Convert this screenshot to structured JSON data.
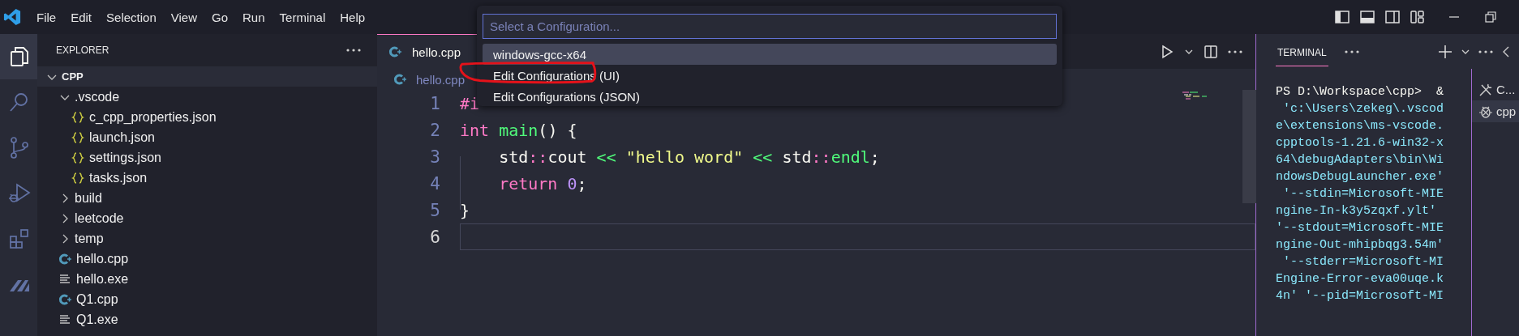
{
  "menu_bar": {
    "items": [
      "File",
      "Edit",
      "Selection",
      "View",
      "Go",
      "Run",
      "Terminal",
      "Help"
    ]
  },
  "activity_bar": [
    {
      "selected": true
    },
    {
      "selected": false
    },
    {
      "selected": false
    },
    {
      "selected": false
    },
    {
      "selected": false
    },
    {
      "selected": false
    }
  ],
  "explorer": {
    "title": "EXPLORER",
    "root": {
      "label": "CPP",
      "kind": "folder",
      "expanded": true,
      "children": [
        {
          "label": ".vscode",
          "kind": "folder",
          "expanded": true,
          "children": [
            {
              "label": "c_cpp_properties.json",
              "kind": "json"
            },
            {
              "label": "launch.json",
              "kind": "json"
            },
            {
              "label": "settings.json",
              "kind": "json"
            },
            {
              "label": "tasks.json",
              "kind": "json"
            }
          ]
        },
        {
          "label": "build",
          "kind": "folder",
          "expanded": false
        },
        {
          "label": "leetcode",
          "kind": "folder",
          "expanded": false
        },
        {
          "label": "temp",
          "kind": "folder",
          "expanded": false
        },
        {
          "label": "hello.cpp",
          "kind": "cpp"
        },
        {
          "label": "hello.exe",
          "kind": "exe"
        },
        {
          "label": "Q1.cpp",
          "kind": "cpp"
        },
        {
          "label": "Q1.exe",
          "kind": "exe"
        }
      ]
    }
  },
  "editor": {
    "tabs": [
      {
        "label": "hello.cpp",
        "selected": true
      }
    ],
    "breadcrumb": "hello.cpp",
    "lines": [
      {
        "number": "1",
        "current": false,
        "tokens": [
          {
            "text": "#i",
            "kind": "preproc"
          }
        ]
      },
      {
        "number": "2",
        "current": false,
        "tokens": [
          {
            "text": "int ",
            "kind": "keyword"
          },
          {
            "text": "main",
            "kind": "function"
          },
          {
            "text": "() {",
            "kind": "plain"
          }
        ]
      },
      {
        "number": "3",
        "current": false,
        "tokens": [
          {
            "text": "    std",
            "kind": "plain"
          },
          {
            "text": "::",
            "kind": "scope"
          },
          {
            "text": "cout ",
            "kind": "plain"
          },
          {
            "text": "<<",
            "kind": "operator"
          },
          {
            "text": " \"hello word\" ",
            "kind": "string"
          },
          {
            "text": "<<",
            "kind": "operator"
          },
          {
            "text": " std",
            "kind": "plain"
          },
          {
            "text": "::",
            "kind": "scope"
          },
          {
            "text": "endl",
            "kind": "function"
          },
          {
            "text": ";",
            "kind": "plain"
          }
        ]
      },
      {
        "number": "4",
        "current": false,
        "tokens": [
          {
            "text": "    return ",
            "kind": "keyword"
          },
          {
            "text": "0",
            "kind": "number"
          },
          {
            "text": ";",
            "kind": "plain"
          }
        ]
      },
      {
        "number": "5",
        "current": false,
        "tokens": [
          {
            "text": "}",
            "kind": "plain"
          }
        ]
      },
      {
        "number": "6",
        "current": true
      }
    ]
  },
  "command_palette": {
    "placeholder": "Select a Configuration...",
    "items": [
      {
        "label": "windows-gcc-x64",
        "selected": true
      },
      {
        "label": "Edit Configurations (UI)",
        "selected": false
      },
      {
        "label": "Edit Configurations (JSON)",
        "selected": false
      }
    ]
  },
  "terminal_panel": {
    "tab": "TERMINAL",
    "lines": [
      {
        "text": "PS D:\\Workspace\\cpp>  &",
        "kind": "prompt"
      },
      {
        "text": " 'c:\\Users\\zekeg\\.vscod",
        "kind": "output"
      },
      {
        "text": "e\\extensions\\ms-vscode.",
        "kind": "output"
      },
      {
        "text": "cpptools-1.21.6-win32-x",
        "kind": "output"
      },
      {
        "text": "64\\debugAdapters\\bin\\Wi",
        "kind": "output"
      },
      {
        "text": "ndowsDebugLauncher.exe'",
        "kind": "output"
      },
      {
        "text": " '--stdin=Microsoft-MIE",
        "kind": "output"
      },
      {
        "text": "ngine-In-k3y5zqxf.ylt'",
        "kind": "output"
      },
      {
        "text": "'--stdout=Microsoft-MIE",
        "kind": "output"
      },
      {
        "text": "ngine-Out-mhipbqg3.54m'",
        "kind": "output"
      },
      {
        "text": " '--stderr=Microsoft-MI",
        "kind": "output"
      },
      {
        "text": "Engine-Error-eva00uqe.k",
        "kind": "output"
      },
      {
        "text": "4n' '--pid=Microsoft-MI",
        "kind": "output"
      }
    ],
    "sessions": [
      {
        "label": "C...",
        "selected": false
      },
      {
        "label": "cpp",
        "selected": true
      }
    ]
  }
}
